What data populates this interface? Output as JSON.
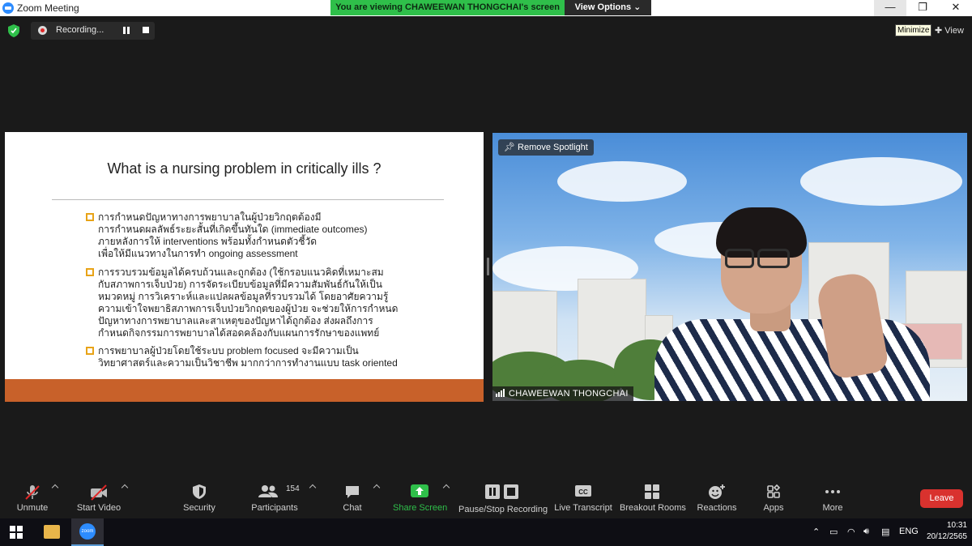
{
  "window": {
    "title": "Zoom Meeting"
  },
  "share_banner": {
    "text": "You are viewing CHAWEEWAN THONGCHAI's screen",
    "view_options": "View Options"
  },
  "recording": {
    "label": "Recording..."
  },
  "tooltip": {
    "minimize": "Minimize"
  },
  "view_label": "View",
  "slide": {
    "title": "What is a nursing problem in critically ills ?",
    "bullets": [
      [
        "การกำหนดปัญหาทางการพยาบาลในผู้ป่วยวิกฤตต้องมี",
        "การกำหนดผลลัพธ์ระยะสั้นที่เกิดขึ้นทันใด (immediate outcomes)",
        "ภายหลังการให้ interventions พร้อมทั้งกำหนดตัวชี้วัด",
        "เพื่อให้มีแนวทางในการทำ ongoing assessment"
      ],
      [
        "การรวบรวมข้อมูลได้ครบถ้วนและถูกต้อง (ใช้กรอบแนวคิดที่เหมาะสม",
        "กับสภาพการเจ็บป่วย) การจัดระเบียบข้อมูลที่มีความสัมพันธ์กันให้เป็น",
        "หมวดหมู่ การวิเคราะห์และแปลผลข้อมูลที่รวบรวมได้ โดยอาศัยความรู้",
        "ความเข้าใจพยาธิสภาพการเจ็บป่วยวิกฤตของผู้ป่วย จะช่วยให้การกำหนด",
        "ปัญหาทางการพยาบาลและสาเหตุของปัญหาได้ถูกต้อง ส่งผลถึงการ",
        "กำหนดกิจกรรมการพยาบาลได้สอดคล้องกับแผนการรักษาของแพทย์"
      ],
      [
        "การพยาบาลผู้ป่วยโดยใช้ระบบ problem focused จะมีความเป็น",
        "วิทยาศาสตร์และความเป็นวิชาชีพ มากกว่าการทำงานแบบ task oriented"
      ]
    ]
  },
  "video": {
    "spotlight": "Remove Spotlight",
    "participant_name": "CHAWEEWAN THONGCHAI"
  },
  "toolbar": {
    "unmute": "Unmute",
    "start_video": "Start Video",
    "security": "Security",
    "participants": "Participants",
    "participant_count": "154",
    "chat": "Chat",
    "share_screen": "Share Screen",
    "recording": "Pause/Stop Recording",
    "live_transcript": "Live Transcript",
    "breakout_rooms": "Breakout Rooms",
    "reactions": "Reactions",
    "apps": "Apps",
    "more": "More",
    "leave": "Leave",
    "cc": "CC"
  },
  "taskbar": {
    "zoom": "zoom",
    "language": "ENG",
    "time": "10:31",
    "date": "20/12/2565"
  },
  "colors": {
    "share_green": "#2fbf4a",
    "leave_red": "#d9322e",
    "slide_footer": "#c8612a",
    "bullet_box": "#e8a317"
  }
}
